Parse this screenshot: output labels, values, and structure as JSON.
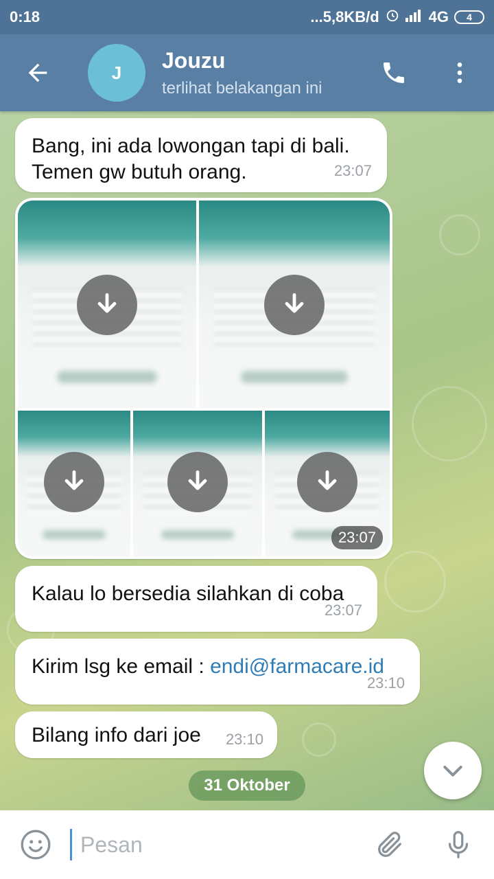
{
  "status_bar": {
    "time": "0:18",
    "network_speed": "...5,8KB/d",
    "network_type": "4G",
    "battery": "4"
  },
  "header": {
    "avatar_letter": "J",
    "name": "Jouzu",
    "status": "terlihat belakangan ini"
  },
  "messages": [
    {
      "text": "Bang, ini ada lowongan tapi di bali. Temen gw butuh orang.",
      "time": "23:07"
    },
    {
      "media_time": "23:07",
      "image_count": 5
    },
    {
      "text": "Kalau lo bersedia silahkan di coba",
      "time": "23:07"
    },
    {
      "text_prefix": "Kirim lsg ke email : ",
      "link": "endi@farmacare.id",
      "time": "23:10"
    },
    {
      "text": "Bilang info dari joe",
      "time": "23:10"
    }
  ],
  "date_divider": "31 Oktober",
  "composer": {
    "placeholder": "Pesan"
  },
  "colors": {
    "header": "#5a7fa5",
    "status_bar": "#4f7397",
    "avatar": "#6bc0d8",
    "link": "#2f7cb5"
  },
  "icons": [
    "back-arrow-icon",
    "phone-icon",
    "more-vertical-icon",
    "download-icon",
    "chevron-down-icon",
    "emoji-icon",
    "attach-icon",
    "mic-icon"
  ]
}
